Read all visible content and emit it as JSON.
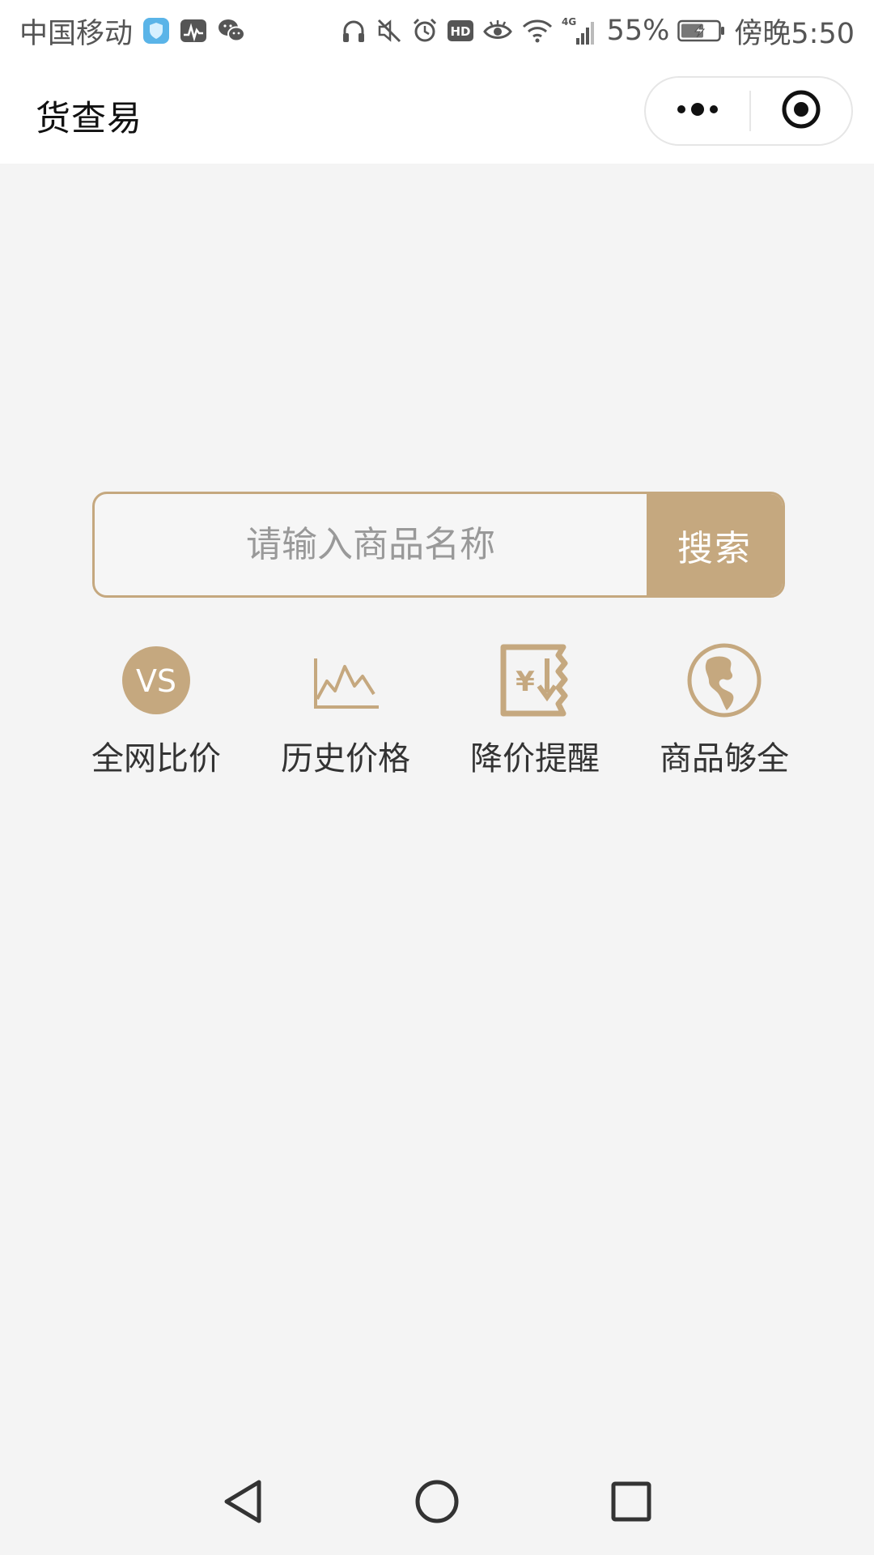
{
  "status_bar": {
    "carrier": "中国移动",
    "signal_type": "4G",
    "battery": "55%",
    "time": "傍晚5:50",
    "left_icons": [
      "security-shield-icon",
      "activity-monitor-icon",
      "wechat-icon"
    ],
    "right_icons": [
      "headphones-icon",
      "mute-icon",
      "alarm-icon",
      "hd-icon",
      "eye-comfort-icon",
      "wifi-icon",
      "cellular-signal-icon",
      "battery-charging-icon"
    ]
  },
  "header": {
    "title": "货查易",
    "menu_icon": "more-dots-icon",
    "close_icon": "close-miniprogram-icon"
  },
  "search": {
    "placeholder": "请输入商品名称",
    "value": "",
    "button_label": "搜索"
  },
  "features": [
    {
      "label": "全网比价",
      "icon": "vs-compare-icon"
    },
    {
      "label": "历史价格",
      "icon": "price-trend-icon"
    },
    {
      "label": "降价提醒",
      "icon": "price-drop-alert-icon"
    },
    {
      "label": "商品够全",
      "icon": "globe-icon"
    }
  ],
  "colors": {
    "accent": "#c5a87f",
    "background": "#f4f4f4",
    "bar_background": "#ffffff",
    "text": "#333333",
    "placeholder": "#999999"
  },
  "nav": {
    "icons": [
      "back-triangle-icon",
      "home-circle-icon",
      "recents-square-icon"
    ]
  }
}
